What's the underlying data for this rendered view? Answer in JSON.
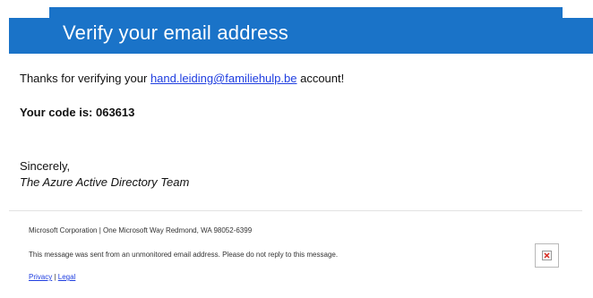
{
  "header": {
    "title": "Verify your email address"
  },
  "body": {
    "thanks_prefix": "Thanks for verifying your ",
    "email": "hand.leiding@familiehulp.be",
    "thanks_suffix": " account!",
    "code_line": "Your code is: 063613",
    "sign_off": "Sincerely,",
    "team": "The Azure Active Directory Team"
  },
  "footer": {
    "address": "Microsoft Corporation | One Microsoft Way Redmond, WA 98052-6399",
    "note": "This message was sent from an unmonitored email address. Please do not reply to this message.",
    "privacy_label": "Privacy",
    "separator": " | ",
    "legal_label": "Legal"
  },
  "icons": {
    "footer_image": "broken-image-icon"
  },
  "colors": {
    "header_blue": "#1a73c8",
    "link_blue": "#1f3ee0",
    "broken_x_red": "#d9261c"
  }
}
